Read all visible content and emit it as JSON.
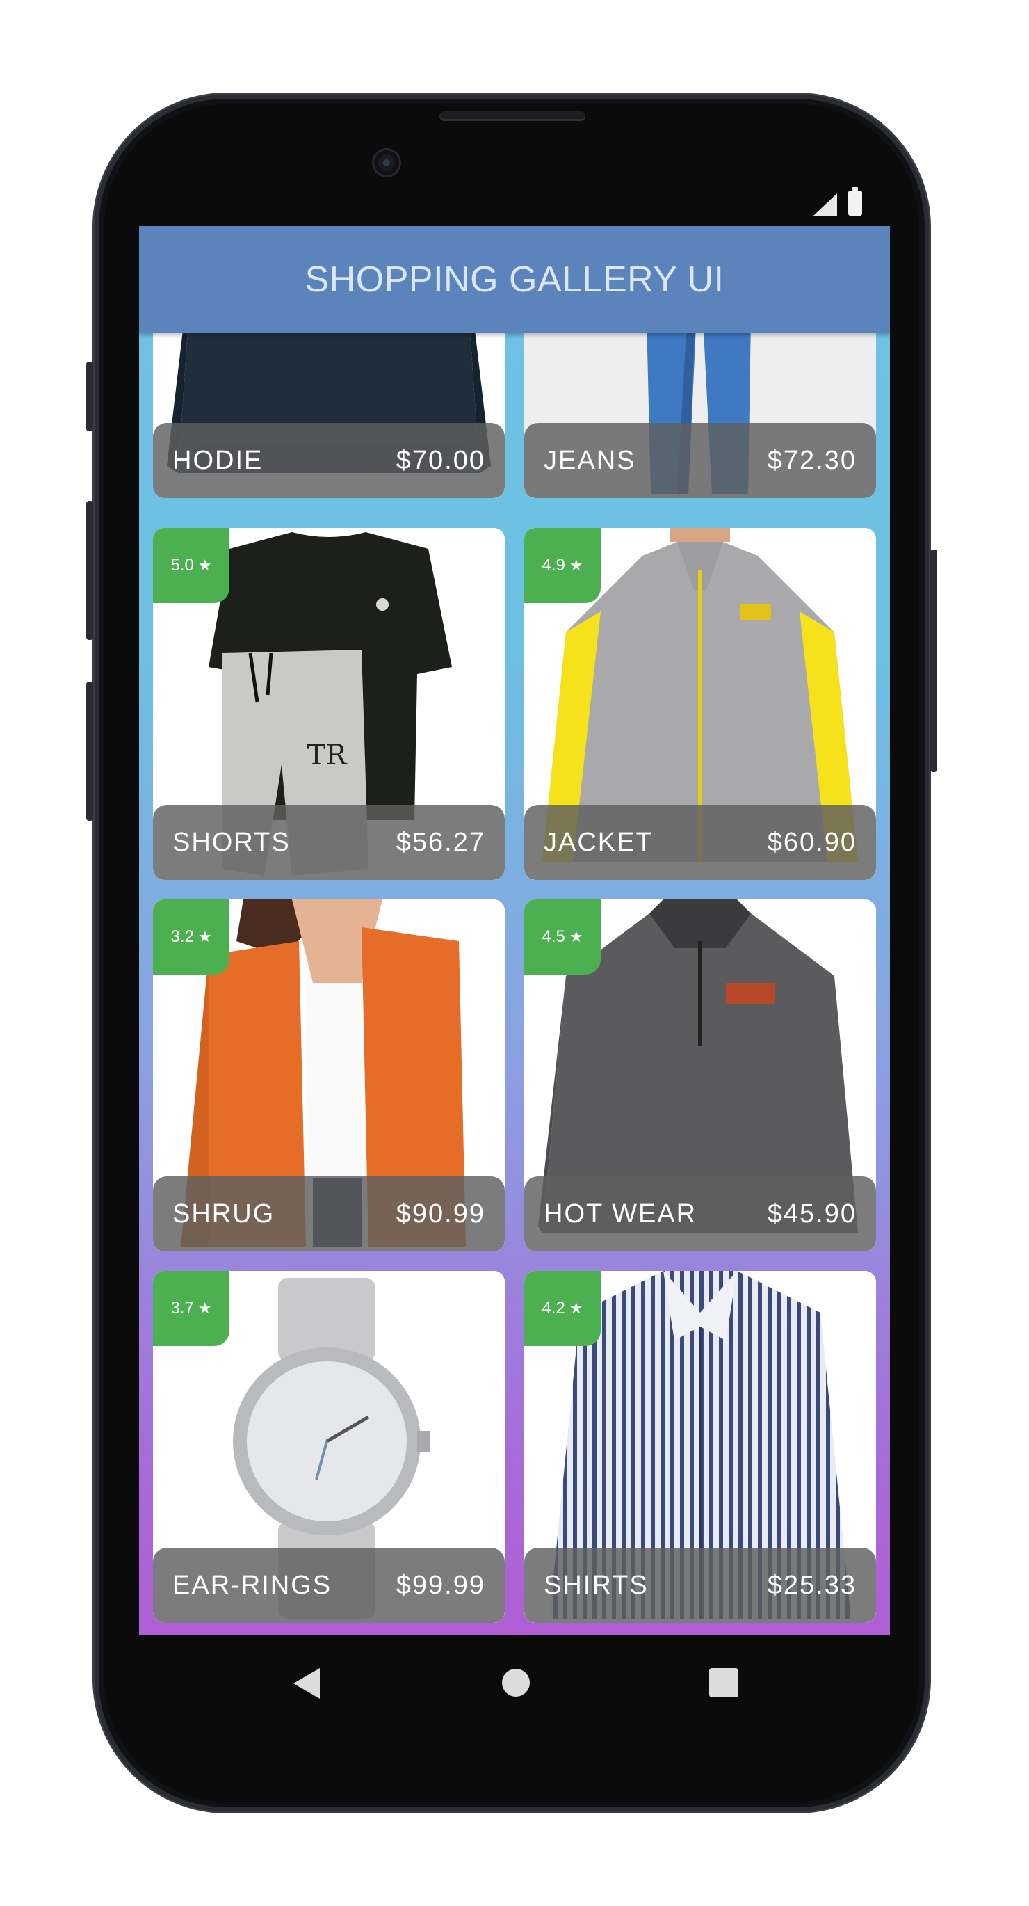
{
  "app": {
    "title": "SHOPPING GALLERY UI"
  },
  "colors": {
    "appbar": "#5c84bc",
    "rating_badge": "#4caf50",
    "gradient_top": "#6ec2e3",
    "gradient_bottom": "#b05ed6"
  },
  "products": [
    {
      "name": "HODIE",
      "price": "$70.00",
      "rating": "",
      "icon": "sweatshirt-image"
    },
    {
      "name": "JEANS",
      "price": "$72.30",
      "rating": "",
      "icon": "jeans-image"
    },
    {
      "name": "SHORTS",
      "price": "$56.27",
      "rating": "5.0",
      "icon": "tshirt-shorts-image"
    },
    {
      "name": "JACKET",
      "price": "$60.90",
      "rating": "4.9",
      "icon": "track-jacket-image"
    },
    {
      "name": "SHRUG",
      "price": "$90.99",
      "rating": "3.2",
      "icon": "orange-shrug-image"
    },
    {
      "name": "HOT WEAR",
      "price": "$45.90",
      "rating": "4.5",
      "icon": "fleece-pullover-image"
    },
    {
      "name": "EAR-RINGS",
      "price": "$99.99",
      "rating": "3.7",
      "icon": "wristwatch-image"
    },
    {
      "name": "SHIRTS",
      "price": "$25.33",
      "rating": "4.2",
      "icon": "striped-shirt-image"
    }
  ],
  "star_glyph": "★",
  "nav": {
    "icons": [
      "back-icon",
      "home-icon",
      "recents-icon"
    ]
  }
}
